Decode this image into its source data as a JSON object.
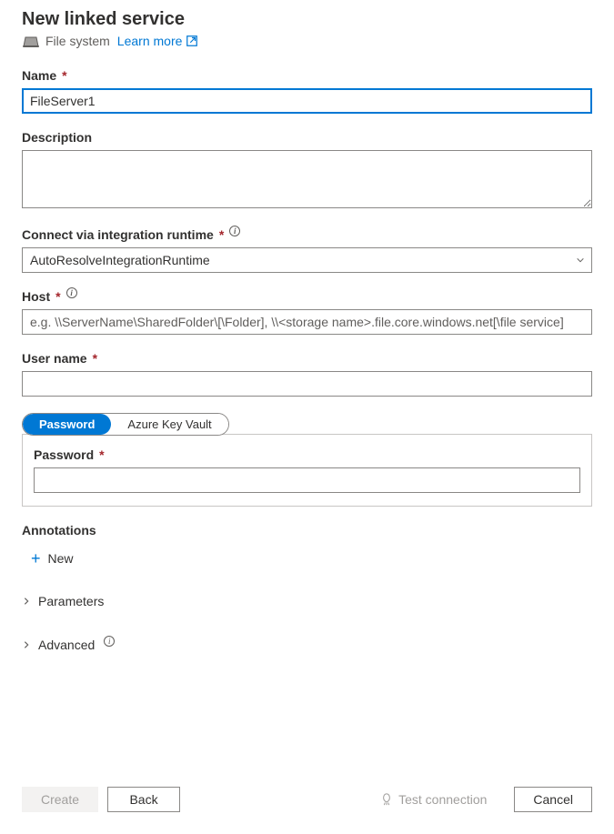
{
  "header": {
    "title": "New linked service",
    "subtitle": "File system",
    "learn_more": "Learn more"
  },
  "fields": {
    "name": {
      "label": "Name",
      "value": "FileServer1"
    },
    "description": {
      "label": "Description",
      "value": ""
    },
    "runtime": {
      "label": "Connect via integration runtime",
      "value": "AutoResolveIntegrationRuntime"
    },
    "host": {
      "label": "Host",
      "value": "",
      "placeholder": "e.g. \\\\ServerName\\SharedFolder\\[\\Folder], \\\\<storage name>.file.core.windows.net[\\file service]"
    },
    "username": {
      "label": "User name",
      "value": ""
    },
    "password_tab": {
      "options": {
        "password": "Password",
        "akv": "Azure Key Vault"
      },
      "inner_label": "Password",
      "value": ""
    }
  },
  "annotations": {
    "heading": "Annotations",
    "new_label": "New"
  },
  "sections": {
    "parameters": "Parameters",
    "advanced": "Advanced"
  },
  "footer": {
    "create": "Create",
    "back": "Back",
    "test": "Test connection",
    "cancel": "Cancel"
  }
}
